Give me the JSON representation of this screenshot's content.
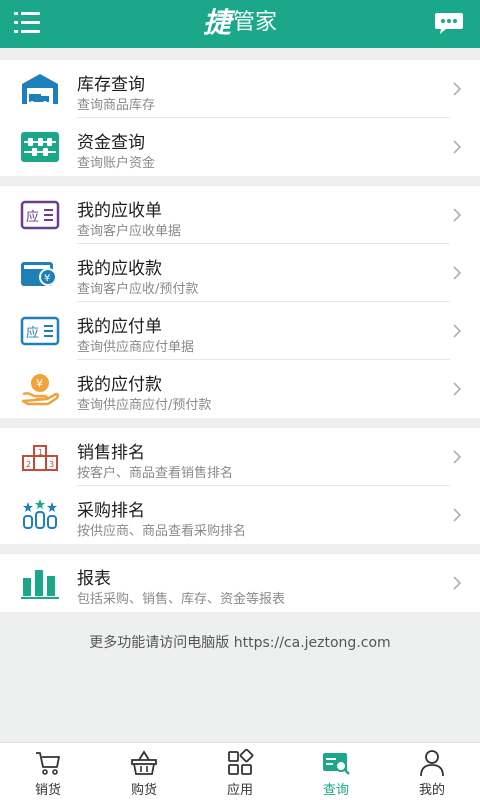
{
  "header": {
    "logo_char": "捷",
    "title": "管家"
  },
  "groups": [
    {
      "items": [
        {
          "title": "库存查询",
          "subtitle": "查询商品库存",
          "icon": "warehouse-icon"
        },
        {
          "title": "资金查询",
          "subtitle": "查询账户资金",
          "icon": "abacus-icon"
        }
      ]
    },
    {
      "items": [
        {
          "title": "我的应收单",
          "subtitle": "查询客户应收单据",
          "icon": "receivable-doc-icon"
        },
        {
          "title": "我的应收款",
          "subtitle": "查询客户应收/预付款",
          "icon": "wallet-yen-icon"
        },
        {
          "title": "我的应付单",
          "subtitle": "查询供应商应付单据",
          "icon": "payable-doc-icon"
        },
        {
          "title": "我的应付款",
          "subtitle": "查询供应商应付/预付款",
          "icon": "hand-coin-icon"
        }
      ]
    },
    {
      "items": [
        {
          "title": "销售排名",
          "subtitle": "按客户、商品查看销售排名",
          "icon": "podium-icon"
        },
        {
          "title": "采购排名",
          "subtitle": "按供应商、商品查看采购排名",
          "icon": "ranking-stars-icon"
        }
      ]
    },
    {
      "items": [
        {
          "title": "报表",
          "subtitle": "包括采购、销售、库存、资金等报表",
          "icon": "bar-chart-icon"
        }
      ]
    }
  ],
  "footer_note": "更多功能请访问电脑版 https://ca.jeztong.com",
  "tabbar": [
    {
      "label": "销货",
      "icon": "cart-icon"
    },
    {
      "label": "购货",
      "icon": "basket-icon"
    },
    {
      "label": "应用",
      "icon": "apps-grid-icon"
    },
    {
      "label": "查询",
      "icon": "query-icon",
      "active": true
    },
    {
      "label": "我的",
      "icon": "user-icon"
    }
  ],
  "colors": {
    "brand": "#1aa78a",
    "purple": "#6b3a91",
    "blue": "#1f7fb8",
    "orange": "#f2a23a",
    "red": "#c44a3a"
  }
}
